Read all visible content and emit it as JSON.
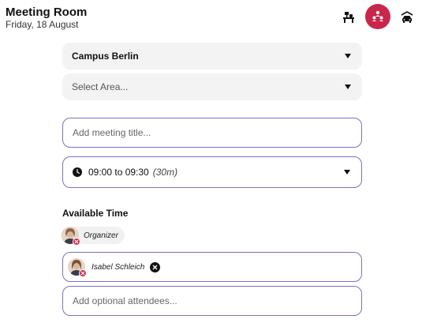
{
  "header": {
    "title": "Meeting Room",
    "date": "Friday, 18 August",
    "icons": [
      "desk-icon",
      "meeting-room-icon",
      "car-parking-icon"
    ],
    "accent_color": "#c8274b"
  },
  "form": {
    "campus": {
      "value": "Campus Berlin"
    },
    "area": {
      "placeholder": "Select Area..."
    },
    "meeting_title": {
      "placeholder": "Add meeting title..."
    },
    "time": {
      "range": "09:00 to 09:30",
      "duration": "(30m)"
    },
    "available_time_title": "Available Time",
    "organizer": {
      "label": "Organizer"
    },
    "attendees": [
      {
        "name": "Isabel Schleich"
      }
    ],
    "optional_attendees": {
      "placeholder": "Add optional attendees..."
    }
  }
}
